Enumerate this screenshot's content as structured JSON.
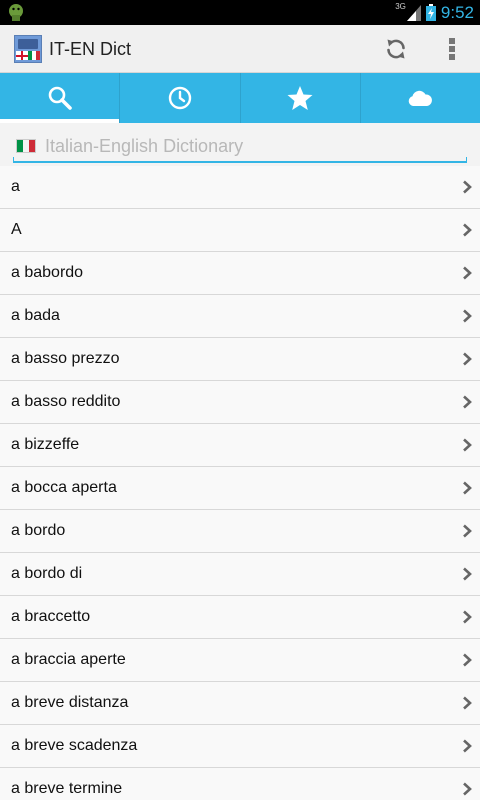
{
  "status_bar": {
    "network_label": "3G",
    "time": "9:52",
    "icons": [
      "android-notification-icon",
      "signal-icon",
      "battery-charging-icon"
    ]
  },
  "action_bar": {
    "title": "IT-EN Dict",
    "icons": [
      "app-logo-icon",
      "refresh-icon",
      "overflow-menu-icon"
    ]
  },
  "tabs": [
    {
      "icon": "search-icon",
      "active": true
    },
    {
      "icon": "history-clock-icon",
      "active": false
    },
    {
      "icon": "favorites-star-icon",
      "active": false
    },
    {
      "icon": "cloud-icon",
      "active": false
    }
  ],
  "search": {
    "placeholder": "Italian-English Dictionary",
    "value": "",
    "flag_icon": "italy-flag-icon"
  },
  "words": [
    {
      "text": "a"
    },
    {
      "text": "A"
    },
    {
      "text": "a babordo"
    },
    {
      "text": "a bada"
    },
    {
      "text": "a basso prezzo"
    },
    {
      "text": "a basso reddito"
    },
    {
      "text": "a bizzeffe"
    },
    {
      "text": "a bocca aperta"
    },
    {
      "text": "a bordo"
    },
    {
      "text": "a bordo di"
    },
    {
      "text": "a braccetto"
    },
    {
      "text": "a braccia aperte"
    },
    {
      "text": "a breve distanza"
    },
    {
      "text": "a breve scadenza"
    },
    {
      "text": "a breve termine"
    }
  ],
  "colors": {
    "accent": "#33b5e5",
    "status_bar": "#000000",
    "action_bar": "#f0f0f0",
    "list_background": "#f9f9f9",
    "divider": "#d8d8d8"
  }
}
